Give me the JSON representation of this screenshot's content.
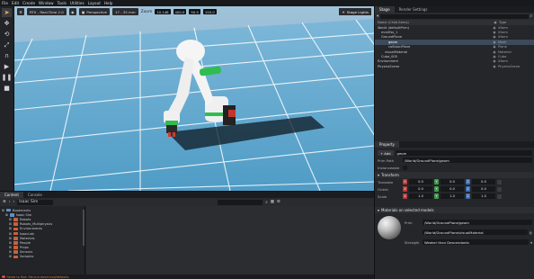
{
  "menu": [
    "File",
    "Edit",
    "Create",
    "Window",
    "Tools",
    "Utilities",
    "Layout",
    "Help"
  ],
  "viewport": {
    "renderer": "RTX - Real-Time 2.0",
    "camera": "Perspective",
    "lens": "17 - 35 mm",
    "zoom_label": "Zoom",
    "zoom_value": "10.148",
    "focus_value": "400.0",
    "fov_value": "50.0",
    "dist_value": "150.0",
    "stage_lights": "Stage Lights"
  },
  "stage": {
    "tabs": [
      "Stage",
      "Render Settings"
    ],
    "columns": {
      "name": "Name (Child Items)",
      "type": "Type"
    },
    "tree": [
      {
        "name": "World (defaultPrim)",
        "type": "Xform",
        "indent": 0,
        "selected": false
      },
      {
        "name": "mrx0fss_1",
        "type": "Xform",
        "indent": 1,
        "selected": false
      },
      {
        "name": "GroundPlane",
        "type": "Xform",
        "indent": 1,
        "selected": false
      },
      {
        "name": "geom",
        "type": "Mesh",
        "indent": 3,
        "selected": true
      },
      {
        "name": "collisionPlane",
        "type": "Plane",
        "indent": 3,
        "selected": false
      },
      {
        "name": "visualMaterial",
        "type": "Material",
        "indent": 2,
        "selected": false
      },
      {
        "name": "Cube_005",
        "type": "Cube",
        "indent": 1,
        "selected": false
      },
      {
        "name": "Environment",
        "type": "Xform",
        "indent": 0,
        "selected": false
      },
      {
        "name": "PhysicsScene",
        "type": "PhysicsScene",
        "indent": 0,
        "selected": false
      }
    ]
  },
  "property": {
    "tabs": [
      "Property"
    ],
    "add_label": "Add",
    "add_value": "geom",
    "prim_path_label": "Prim Path",
    "prim_path_value": "/World/GroundPlane/geom",
    "instanceable_label": "Instanceable",
    "transform_section": "Transform",
    "transform": [
      {
        "label": "Translate",
        "x": "0.0",
        "y": "0.0",
        "z": "0.0"
      },
      {
        "label": "Orient",
        "x": "0.0",
        "y": "0.0",
        "z": "0.0"
      },
      {
        "label": "Scale",
        "x": "1.0",
        "y": "1.0",
        "z": "1.0"
      }
    ],
    "material_section": "Materials on selected models",
    "prim_label": "Prim",
    "prim_value": "/World/GroundPlane/geom",
    "material_value": "/World/GroundPlane/visualMaterial",
    "strength_label": "Strength",
    "strength_value": "Weaker than Descendants"
  },
  "content": {
    "tabs": [
      "Content",
      "Console"
    ],
    "path_label": "Isaac Sim",
    "folders": [
      {
        "name": "Bookmarks",
        "indent": 0
      },
      {
        "name": "Isaac Sim",
        "indent": 1
      },
      {
        "name": "Robots",
        "indent": 2
      },
      {
        "name": "Robots_Multiphysics",
        "indent": 2
      },
      {
        "name": "Environments",
        "indent": 2
      },
      {
        "name": "IsaacLab",
        "indent": 2
      },
      {
        "name": "Materials",
        "indent": 2
      },
      {
        "name": "People",
        "indent": 2
      },
      {
        "name": "Props",
        "indent": 2
      },
      {
        "name": "Sensors",
        "indent": 2
      },
      {
        "name": "Samples",
        "indent": 2
      }
    ],
    "status_text": "Failed to find: file:/cui.dev/mcsd/defaults"
  },
  "colors": {
    "sky": "#8fb7cf",
    "grid_floor": "#5aa2c9",
    "robot_body": "#f0f0f0",
    "robot_accent": "#2fbd4f",
    "accent_orange": "#f2b64a"
  }
}
